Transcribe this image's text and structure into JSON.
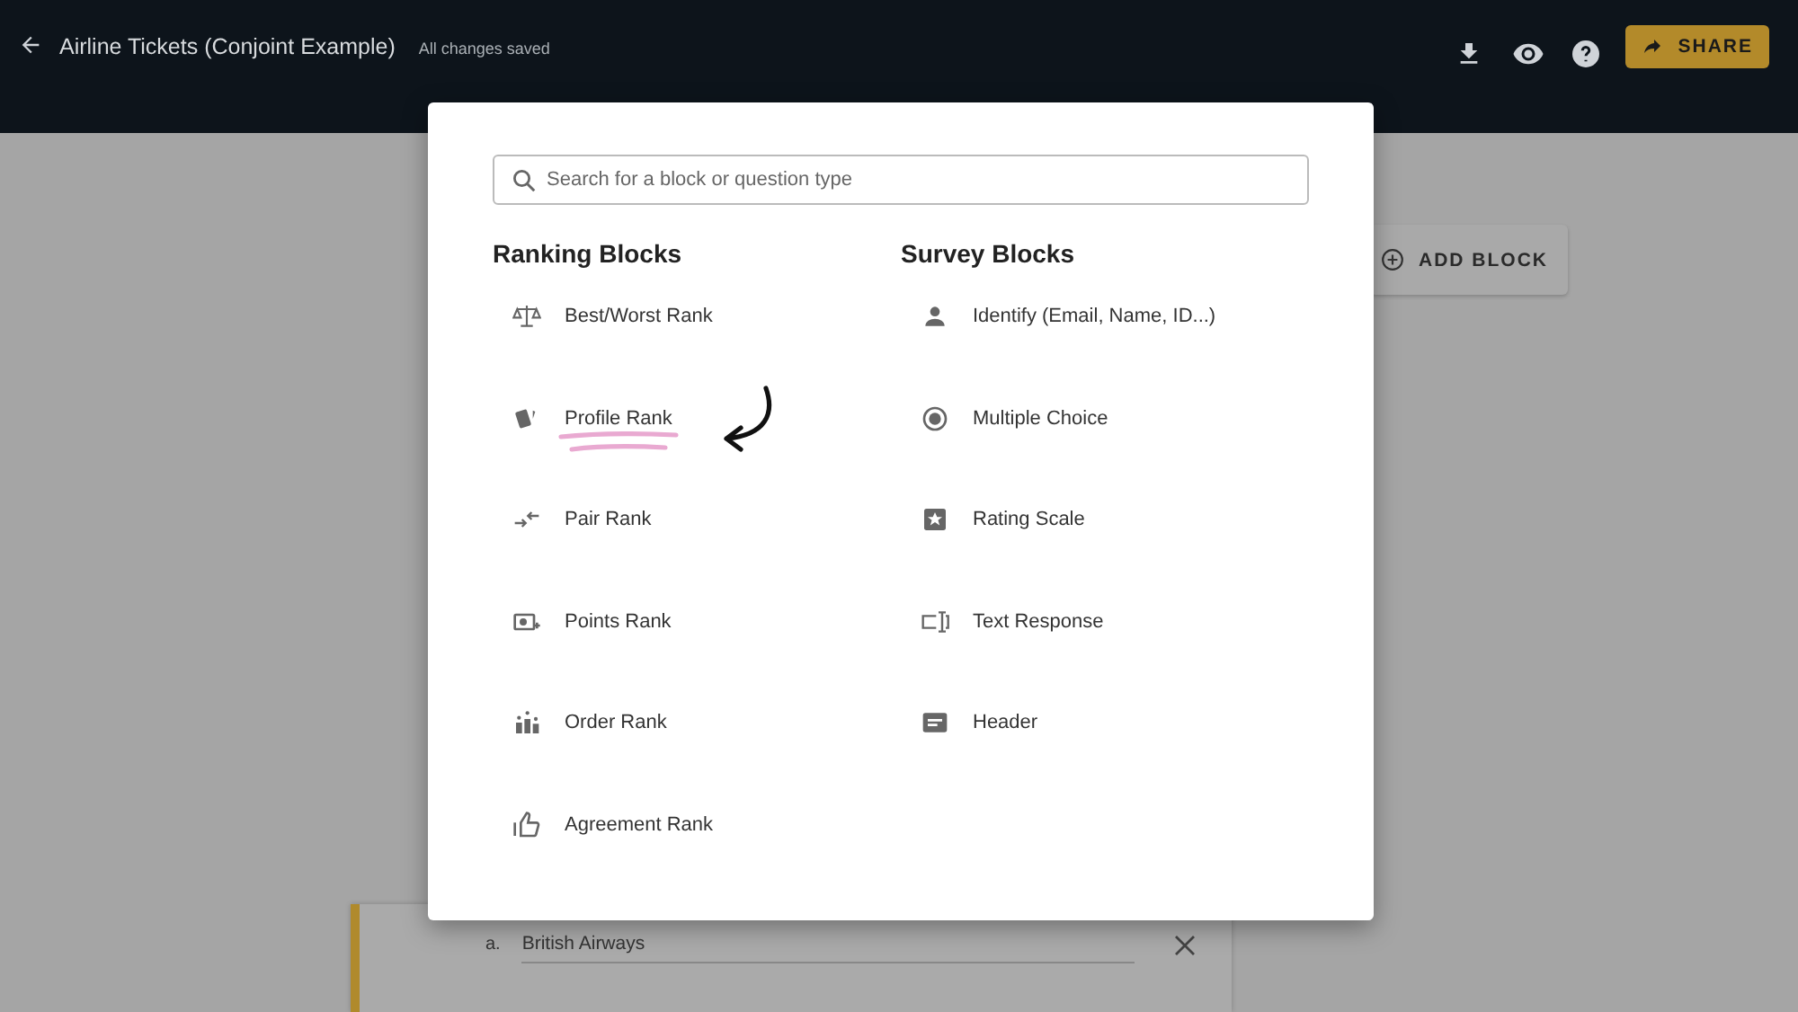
{
  "topbar": {
    "title": "Airline Tickets (Conjoint Example)",
    "save_status": "All changes saved",
    "share_label": "SHARE"
  },
  "background": {
    "add_block_label": "ADD BLOCK",
    "answers": [
      {
        "letter": "a.",
        "value": "British Airways"
      }
    ]
  },
  "modal": {
    "search": {
      "placeholder": "Search for a block or question type"
    },
    "columns": [
      {
        "heading": "Ranking Blocks",
        "items": [
          {
            "label": "Best/Worst Rank",
            "highlighted": false
          },
          {
            "label": "Profile Rank",
            "highlighted": true
          },
          {
            "label": "Pair Rank",
            "highlighted": false
          },
          {
            "label": "Points Rank",
            "highlighted": false
          },
          {
            "label": "Order Rank",
            "highlighted": false
          },
          {
            "label": "Agreement Rank",
            "highlighted": false
          }
        ]
      },
      {
        "heading": "Survey Blocks",
        "items": [
          {
            "label": "Identify (Email, Name, ID...)",
            "highlighted": false
          },
          {
            "label": "Multiple Choice",
            "highlighted": false
          },
          {
            "label": "Rating Scale",
            "highlighted": false
          },
          {
            "label": "Text Response",
            "highlighted": false
          },
          {
            "label": "Header",
            "highlighted": false
          }
        ]
      }
    ]
  }
}
